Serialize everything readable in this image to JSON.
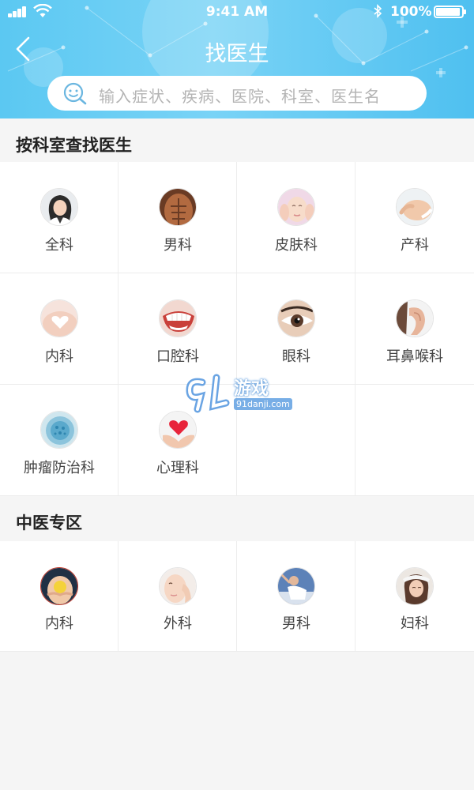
{
  "status_bar": {
    "time": "9:41 AM",
    "battery": "100%"
  },
  "nav": {
    "title": "找医生"
  },
  "search": {
    "placeholder": "输入症状、疾病、医院、科室、医生名"
  },
  "departments": {
    "title": "按科室查找医生",
    "items": [
      {
        "label": "全科",
        "icon": "doctor-portrait"
      },
      {
        "label": "男科",
        "icon": "male-torso"
      },
      {
        "label": "皮肤科",
        "icon": "face-skin"
      },
      {
        "label": "产科",
        "icon": "pregnant-belly"
      },
      {
        "label": "内科",
        "icon": "heart-hands"
      },
      {
        "label": "口腔科",
        "icon": "teeth"
      },
      {
        "label": "眼科",
        "icon": "eye"
      },
      {
        "label": "耳鼻喉科",
        "icon": "ear"
      },
      {
        "label": "肿瘤防治科",
        "icon": "cell"
      },
      {
        "label": "心理科",
        "icon": "heart-in-hands"
      }
    ]
  },
  "tcm": {
    "title": "中医专区",
    "items": [
      {
        "label": "内科",
        "icon": "stomach"
      },
      {
        "label": "外科",
        "icon": "face-hand"
      },
      {
        "label": "男科",
        "icon": "man-stretch"
      },
      {
        "label": "妇科",
        "icon": "woman-headache"
      }
    ]
  },
  "watermark": {
    "name": "游戏",
    "url": "91danji.com"
  },
  "colors": {
    "header": "#5bc8f2",
    "search_text": "#b4b4b4"
  }
}
